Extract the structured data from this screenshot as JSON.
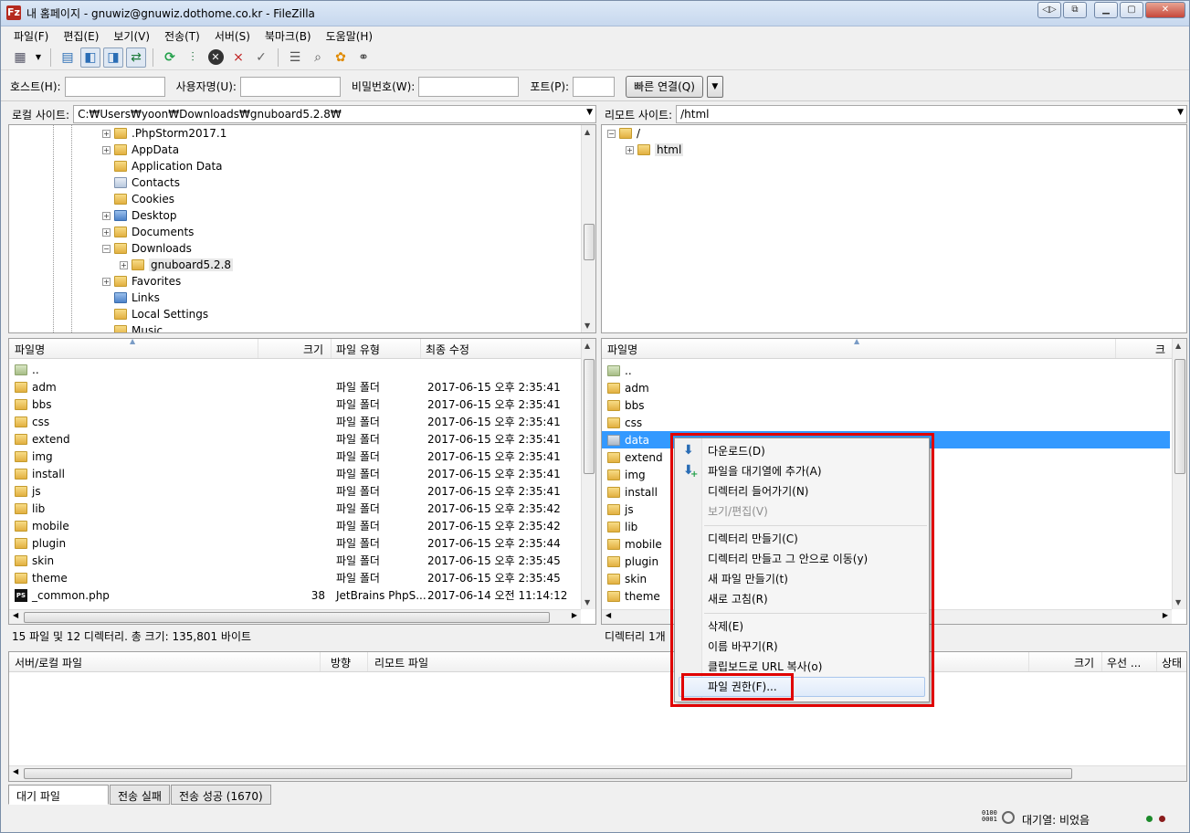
{
  "window": {
    "title": "내 홈페이지 - gnuwiz@gnuwiz.dothome.co.kr - FileZilla",
    "app_icon": "Fz"
  },
  "menu": [
    "파일(F)",
    "편집(E)",
    "보기(V)",
    "전송(T)",
    "서버(S)",
    "북마크(B)",
    "도움말(H)"
  ],
  "quickconnect": {
    "host_label": "호스트(H):",
    "host_value": "",
    "user_label": "사용자명(U):",
    "user_value": "",
    "pass_label": "비밀번호(W):",
    "pass_value": "",
    "port_label": "포트(P):",
    "port_value": "",
    "connect_label": "빠른 연결(Q)"
  },
  "local": {
    "site_label": "로컬 사이트:",
    "site_path": "C:₩Users₩yoon₩Downloads₩gnuboard5.2.8₩",
    "tree": [
      {
        "name": ".PhpStorm2017.1",
        "type": "folder"
      },
      {
        "name": "AppData",
        "type": "folder"
      },
      {
        "name": "Application Data",
        "type": "folder"
      },
      {
        "name": "Contacts",
        "type": "contacts"
      },
      {
        "name": "Cookies",
        "type": "folder"
      },
      {
        "name": "Desktop",
        "type": "desktop"
      },
      {
        "name": "Documents",
        "type": "folder"
      },
      {
        "name": "Downloads",
        "type": "downloads"
      },
      {
        "name": "gnuboard5.2.8",
        "type": "folder"
      },
      {
        "name": "Favorites",
        "type": "star"
      },
      {
        "name": "Links",
        "type": "links"
      },
      {
        "name": "Local Settings",
        "type": "folder"
      },
      {
        "name": "Music",
        "type": "folder"
      }
    ],
    "headers": {
      "name": "파일명",
      "size": "크기",
      "type": "파일 유형",
      "modified": "최종 수정"
    },
    "files": [
      {
        "name": "..",
        "size": "",
        "type": "",
        "modified": ""
      },
      {
        "name": "adm",
        "size": "",
        "type": "파일 폴더",
        "modified": "2017-06-15 오후 2:35:41"
      },
      {
        "name": "bbs",
        "size": "",
        "type": "파일 폴더",
        "modified": "2017-06-15 오후 2:35:41"
      },
      {
        "name": "css",
        "size": "",
        "type": "파일 폴더",
        "modified": "2017-06-15 오후 2:35:41"
      },
      {
        "name": "extend",
        "size": "",
        "type": "파일 폴더",
        "modified": "2017-06-15 오후 2:35:41"
      },
      {
        "name": "img",
        "size": "",
        "type": "파일 폴더",
        "modified": "2017-06-15 오후 2:35:41"
      },
      {
        "name": "install",
        "size": "",
        "type": "파일 폴더",
        "modified": "2017-06-15 오후 2:35:41"
      },
      {
        "name": "js",
        "size": "",
        "type": "파일 폴더",
        "modified": "2017-06-15 오후 2:35:41"
      },
      {
        "name": "lib",
        "size": "",
        "type": "파일 폴더",
        "modified": "2017-06-15 오후 2:35:42"
      },
      {
        "name": "mobile",
        "size": "",
        "type": "파일 폴더",
        "modified": "2017-06-15 오후 2:35:42"
      },
      {
        "name": "plugin",
        "size": "",
        "type": "파일 폴더",
        "modified": "2017-06-15 오후 2:35:44"
      },
      {
        "name": "skin",
        "size": "",
        "type": "파일 폴더",
        "modified": "2017-06-15 오후 2:35:45"
      },
      {
        "name": "theme",
        "size": "",
        "type": "파일 폴더",
        "modified": "2017-06-15 오후 2:35:45"
      },
      {
        "name": "_common.php",
        "size": "38",
        "type": "JetBrains PhpS...",
        "modified": "2017-06-14 오전 11:14:12"
      }
    ],
    "status": "15 파일 및 12 디렉터리. 총 크기: 135,801 바이트"
  },
  "remote": {
    "site_label": "리모트 사이트:",
    "site_path": "/html",
    "tree": [
      {
        "name": "/",
        "type": "folder"
      },
      {
        "name": "html",
        "type": "folder"
      }
    ],
    "headers": {
      "name": "파일명",
      "size": "크"
    },
    "files": [
      "..",
      "adm",
      "bbs",
      "css",
      "data",
      "extend",
      "img",
      "install",
      "js",
      "lib",
      "mobile",
      "plugin",
      "skin",
      "theme"
    ],
    "selected": "data",
    "status": "디렉터리 1개"
  },
  "context_menu": {
    "items": [
      {
        "label": "다운로드(D)",
        "icon": "download-arrow-icon",
        "disabled": false
      },
      {
        "label": "파일을 대기열에 추가(A)",
        "icon": "add-to-queue-icon",
        "disabled": false
      },
      {
        "label": "디렉터리 들어가기(N)",
        "disabled": false
      },
      {
        "label": "보기/편집(V)",
        "disabled": true
      },
      {
        "label": "디렉터리 만들기(C)",
        "disabled": false
      },
      {
        "label": "디렉터리 만들고 그 안으로 이동(y)",
        "disabled": false
      },
      {
        "label": "새 파일 만들기(t)",
        "disabled": false
      },
      {
        "label": "새로 고침(R)",
        "disabled": false
      },
      {
        "label": "삭제(E)",
        "disabled": false
      },
      {
        "label": "이름 바꾸기(R)",
        "disabled": false
      },
      {
        "label": "클립보드로 URL 복사(o)",
        "disabled": false
      },
      {
        "label": "파일 권한(F)...",
        "disabled": false,
        "highlighted": true
      }
    ],
    "highlight_color": "#e00000"
  },
  "queue": {
    "headers": {
      "server_local": "서버/로컬 파일",
      "direction": "방향",
      "remote": "리모트 파일",
      "size": "크기",
      "priority": "우선 ...",
      "state": "상태"
    }
  },
  "tabs": [
    "대기 파일",
    "전송 실패",
    "전송 성공 (1670)"
  ],
  "statusbar": {
    "binary": "0100\n0001",
    "queue": "대기열: 비었음"
  },
  "colors": {
    "selection": "#3399ff",
    "folder": "#e8b84a"
  }
}
